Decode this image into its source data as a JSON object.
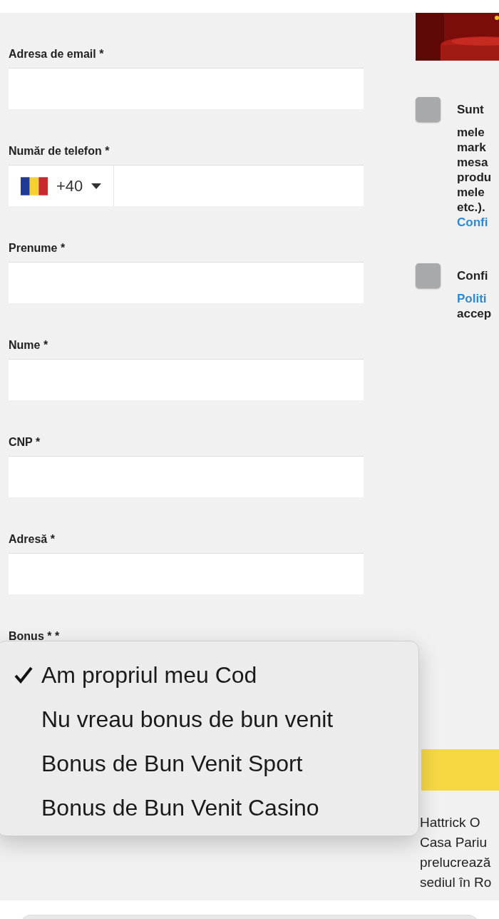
{
  "fields": [
    {
      "kind": "text",
      "label": "Adresa de email *"
    },
    {
      "kind": "phone",
      "label": "Număr de telefon *",
      "country_code": "+40"
    },
    {
      "kind": "text",
      "label": "Prenume *"
    },
    {
      "kind": "text",
      "label": "Nume *"
    },
    {
      "kind": "text",
      "label": "CNP *"
    },
    {
      "kind": "text",
      "label": "Adresă *"
    }
  ],
  "bonus": {
    "label": "Bonus * *",
    "options": [
      {
        "label": "Am propriul meu Cod",
        "selected": true
      },
      {
        "label": "Nu vreau bonus de bun venit",
        "selected": false
      },
      {
        "label": "Bonus de Bun Venit Sport",
        "selected": false
      },
      {
        "label": "Bonus de Bun Venit Casino",
        "selected": false
      }
    ]
  },
  "consents": [
    {
      "checked": false,
      "lines": [
        {
          "text": "Sunt",
          "link": false
        },
        {
          "text": "mele",
          "link": false
        },
        {
          "text": "mark",
          "link": false
        },
        {
          "text": "mesa",
          "link": false
        },
        {
          "text": "produ",
          "link": false
        },
        {
          "text": "mele",
          "link": false
        },
        {
          "text": "etc.).",
          "link": false
        },
        {
          "text": "Confi",
          "link": true
        }
      ]
    },
    {
      "checked": false,
      "lines": [
        {
          "text": "Confi",
          "link": false
        },
        {
          "text": "Politi",
          "link": true
        },
        {
          "text": "accep",
          "link": false
        }
      ]
    }
  ],
  "footer_text": [
    "Hattrick O",
    "Casa Pariu",
    "prelucrează",
    "sediul în Ro"
  ]
}
